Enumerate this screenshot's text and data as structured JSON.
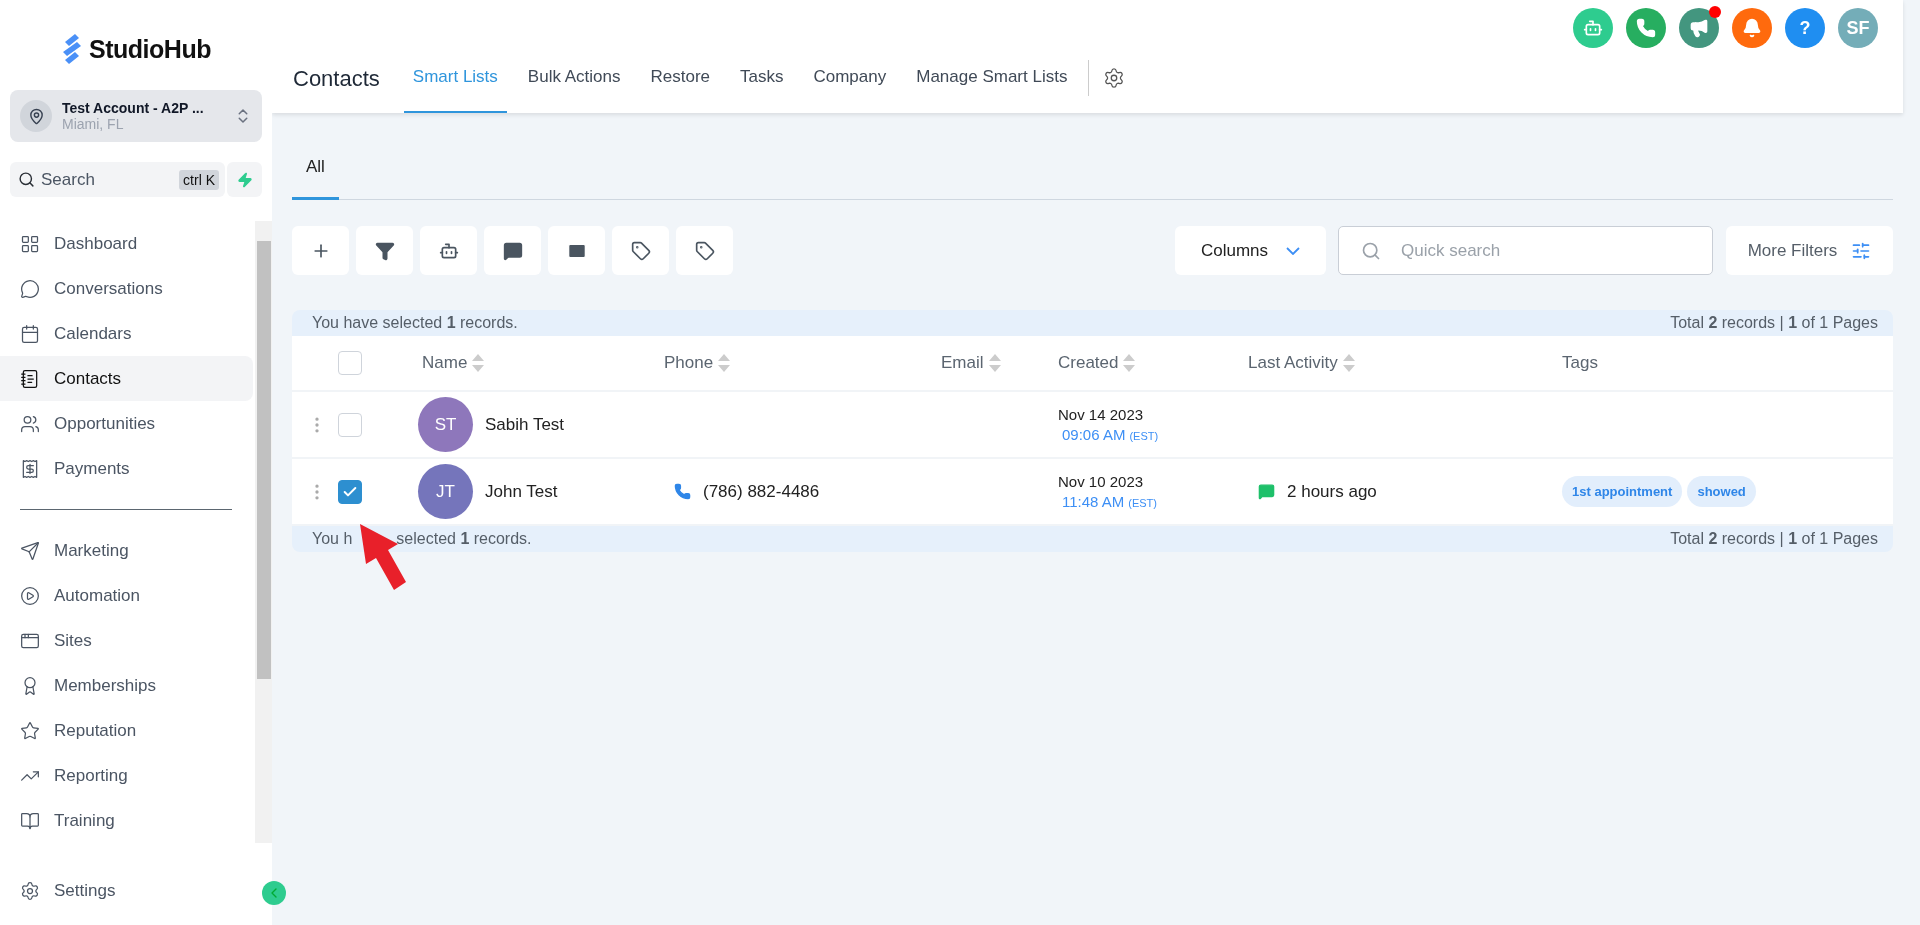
{
  "brand": "StudioHub",
  "account": {
    "name": "Test Account - A2P ...",
    "location": "Miami, FL"
  },
  "search": {
    "placeholder": "Search",
    "shortcut": "ctrl K"
  },
  "nav_main": [
    {
      "label": "Dashboard",
      "selected": false
    },
    {
      "label": "Conversations",
      "selected": false
    },
    {
      "label": "Calendars",
      "selected": false
    },
    {
      "label": "Contacts",
      "selected": true
    },
    {
      "label": "Opportunities",
      "selected": false
    },
    {
      "label": "Payments",
      "selected": false
    }
  ],
  "nav_more": [
    {
      "label": "Marketing",
      "selected": false
    },
    {
      "label": "Automation",
      "selected": false
    },
    {
      "label": "Sites",
      "selected": false
    },
    {
      "label": "Memberships",
      "selected": false
    },
    {
      "label": "Reputation",
      "selected": false
    },
    {
      "label": "Reporting",
      "selected": false
    },
    {
      "label": "Training",
      "selected": false
    }
  ],
  "settings": {
    "label": "Settings"
  },
  "header": {
    "title": "Contacts",
    "tabs": [
      {
        "label": "Smart Lists",
        "selected": true
      },
      {
        "label": "Bulk Actions",
        "selected": false
      },
      {
        "label": "Restore",
        "selected": false
      },
      {
        "label": "Tasks",
        "selected": false
      },
      {
        "label": "Company",
        "selected": false
      },
      {
        "label": "Manage Smart Lists",
        "selected": false
      }
    ]
  },
  "top_actions": [
    {
      "kind": "bot",
      "color": "#2ecc8f",
      "unread": false
    },
    {
      "kind": "phone",
      "color": "#27ae60",
      "unread": false
    },
    {
      "kind": "megaphone",
      "color": "#43967f",
      "unread": true
    },
    {
      "kind": "bell",
      "color": "#ff6a0d",
      "unread": false
    },
    {
      "kind": "help",
      "color": "#1f8ef1",
      "unread": false,
      "label": "?"
    },
    {
      "kind": "avatar",
      "color": "#74adb8",
      "unread": false,
      "label": "SF"
    }
  ],
  "subtabs": [
    {
      "label": "All",
      "selected": true
    }
  ],
  "toolbar": {
    "columns_label": "Columns",
    "search_placeholder": "Quick search",
    "filters_label": "More Filters"
  },
  "table": {
    "summary_top": {
      "selection": "You have selected **1** records.",
      "totals": "Total **2** records | **1** of 1 Pages"
    },
    "header_checked": false,
    "columns": [
      {
        "label": "Name",
        "sortable": true
      },
      {
        "label": "Phone",
        "sortable": true
      },
      {
        "label": "Email",
        "sortable": true
      },
      {
        "label": "Created",
        "sortable": true
      },
      {
        "label": "Last Activity",
        "sortable": true
      },
      {
        "label": "Tags",
        "sortable": false
      }
    ],
    "rows": [
      {
        "initials": "ST",
        "name": "Sabih Test",
        "color": "#8e77bb",
        "checked": false,
        "phone": "",
        "created_date": "Nov 14 2023",
        "created_time": "09:06 AM",
        "created_zone": "(EST)",
        "activity": "",
        "tags": []
      },
      {
        "initials": "JT",
        "name": "John Test",
        "color": "#7575bb",
        "checked": true,
        "phone": "(786) 882-4486",
        "created_date": "Nov 10 2023",
        "created_time": "11:48 AM",
        "created_zone": "(EST)",
        "activity": "2 hours ago",
        "tags": [
          "1st appointment",
          "showed"
        ]
      }
    ],
    "summary_bottom": {
      "selection_before": "You h",
      "selection_after": "selected **1** records.",
      "totals": "Total **2** records | **1** of 1 Pages"
    }
  },
  "annotations": [
    {
      "kind": "arrow",
      "color": "#e8202a"
    }
  ]
}
